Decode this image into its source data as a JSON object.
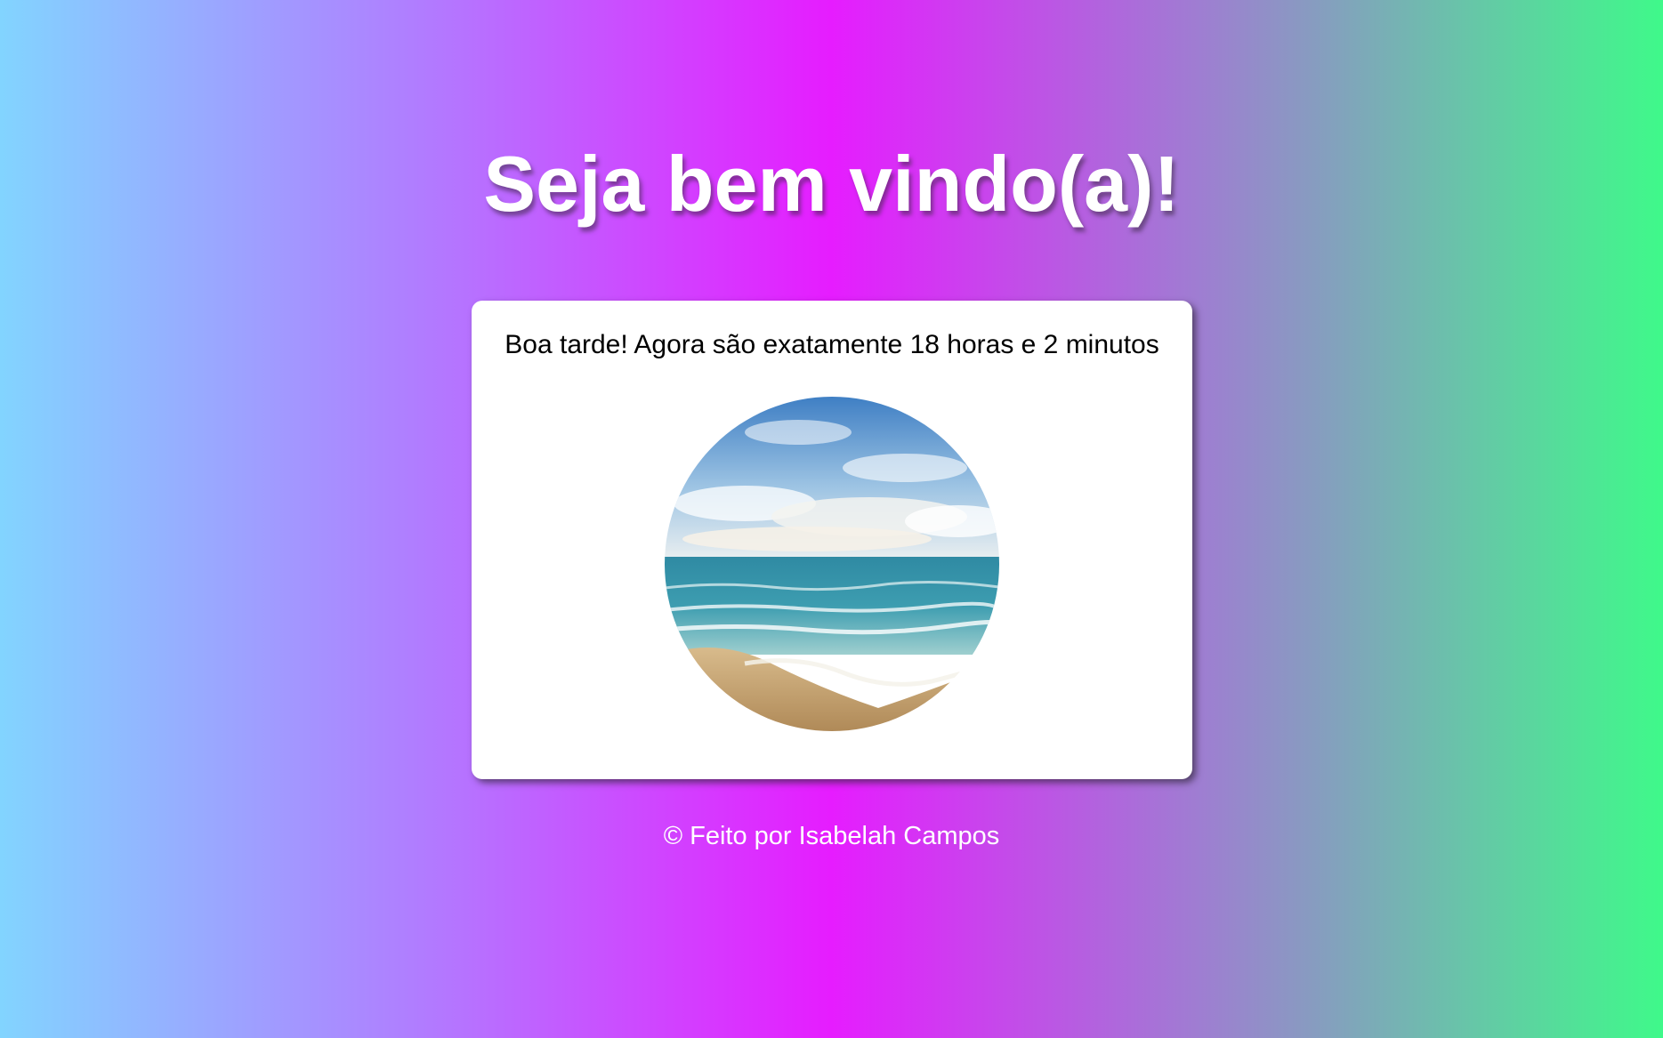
{
  "page": {
    "title": "Seja bem vindo(a)!",
    "background_colors": [
      "#82d4ff",
      "#b476ff",
      "#e61cff",
      "#9f7dd2",
      "#3ff98a"
    ]
  },
  "card": {
    "greeting": "Boa tarde! Agora são exatamente 18 horas e 2 minutos",
    "image": {
      "icon": "beach-photo",
      "description_colors": {
        "sky": "#4f8fcf",
        "sea": "#2d8a9e",
        "sand": "#c9a777"
      }
    }
  },
  "footer": {
    "text": "© Feito por Isabelah Campos"
  }
}
